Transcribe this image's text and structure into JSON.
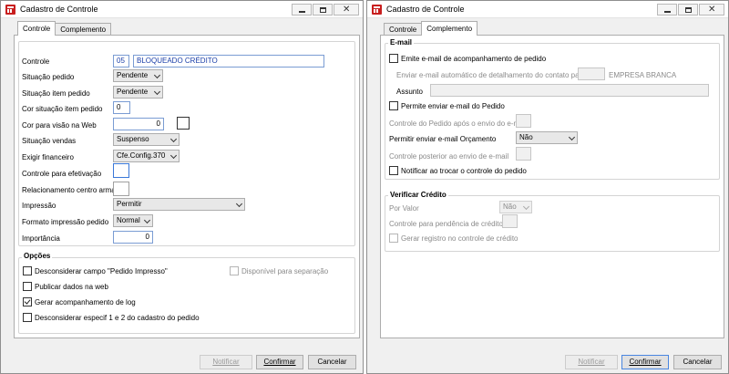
{
  "left_window": {
    "title": "Cadastro de Controle",
    "tabs": [
      {
        "label": "Controle"
      },
      {
        "label": "Complemento"
      }
    ],
    "fields": {
      "controle_label": "Controle",
      "controle_code": "05",
      "controle_name": "BLOQUEADO CRÉDITO",
      "situacao_pedido_label": "Situação pedido",
      "situacao_pedido_value": "Pendente",
      "situacao_item_label": "Situação item pedido",
      "situacao_item_value": "Pendente",
      "cor_situacao_label": "Cor situação item pedido",
      "cor_situacao_value": "0",
      "cor_web_label": "Cor para visão na Web",
      "cor_web_value": "0",
      "situacao_vendas_label": "Situação vendas",
      "situacao_vendas_value": "Suspenso",
      "exigir_financeiro_label": "Exigir financeiro",
      "exigir_financeiro_value": "Cfe.Config.370",
      "controle_efetivacao_label": "Controle para efetivação",
      "relacionamento_label": "Relacionamento centro armaz.",
      "impressao_label": "Impressão",
      "impressao_value": "Permitir",
      "formato_label": "Formato impressão pedido",
      "formato_value": "Normal",
      "importancia_label": "Importância",
      "importancia_value": "0"
    },
    "options": {
      "title": "Opções",
      "desconsiderar_impresso": "Desconsiderar campo \"Pedido Impresso\"",
      "disponivel_separacao": "Disponível para separação",
      "publicar_web": "Publicar dados na web",
      "gerar_log": "Gerar acompanhamento de log",
      "desconsiderar_especif": "Desconsiderar especif 1 e 2 do cadastro do pedido"
    },
    "buttons": {
      "notificar": "Notificar",
      "confirmar": "Confirmar",
      "cancelar": "Cancelar"
    }
  },
  "right_window": {
    "title": "Cadastro de Controle",
    "tabs": [
      {
        "label": "Controle"
      },
      {
        "label": "Complemento"
      }
    ],
    "email": {
      "title": "E-mail",
      "emite_acompanhamento": "Emite e-mail de acompanhamento de pedido",
      "enviar_automatico_label": "Enviar e-mail automático de detalhamento do contato para",
      "empresa_label": "EMPRESA BRANCA",
      "assunto_label": "Assunto",
      "permite_enviar": "Permite enviar e-mail do Pedido",
      "controle_apos_label": "Controle do Pedido após o envio do e-mail",
      "permitir_orcamento_label": "Permitir enviar e-mail Orçamento",
      "permitir_orcamento_value": "Não",
      "controle_posterior_label": "Controle posterior ao envio de e-mail",
      "notificar_troca": "Notificar ao trocar o controle do pedido"
    },
    "credito": {
      "title": "Verificar Crédito",
      "por_valor_label": "Por Valor",
      "por_valor_value": "Não",
      "pendencia_label": "Controle para pendência de crédito",
      "gerar_registro": "Gerar registro no controle de crédito"
    },
    "buttons": {
      "notificar": "Notificar",
      "confirmar": "Confirmar",
      "cancelar": "Cancelar"
    }
  }
}
